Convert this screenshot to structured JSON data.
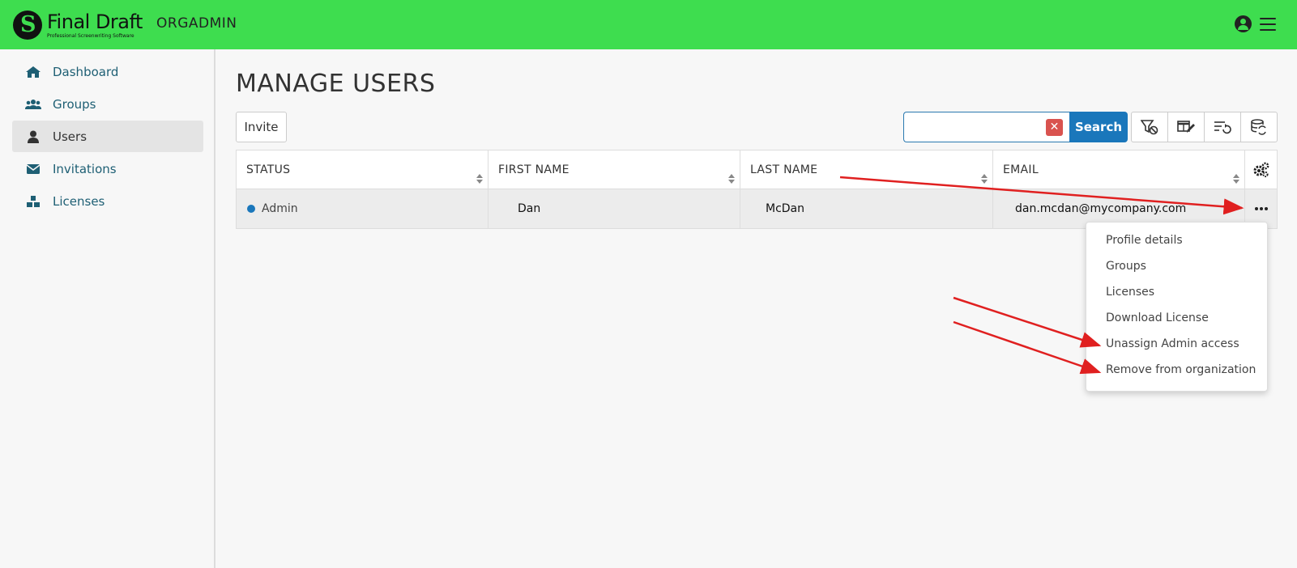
{
  "header": {
    "logo_name": "Final Draft",
    "logo_tagline": "Professional Screenwriting Software",
    "org_name": "ORGADMIN",
    "colors": {
      "bar": "#3edd4f"
    }
  },
  "sidebar": {
    "items": [
      {
        "label": "Dashboard",
        "icon": "home-icon"
      },
      {
        "label": "Groups",
        "icon": "users-icon"
      },
      {
        "label": "Users",
        "icon": "user-icon",
        "active": true
      },
      {
        "label": "Invitations",
        "icon": "envelope-icon"
      },
      {
        "label": "Licenses",
        "icon": "boxes-icon"
      }
    ]
  },
  "main": {
    "title": "MANAGE USERS",
    "invite_label": "Invite",
    "search": {
      "value": "",
      "placeholder": "",
      "button_label": "Search"
    },
    "tools": [
      "clear-filter-icon",
      "edit-columns-icon",
      "reset-sort-icon",
      "refresh-data-icon"
    ]
  },
  "table": {
    "columns": [
      "STATUS",
      "FIRST NAME",
      "LAST NAME",
      "EMAIL"
    ],
    "rows": [
      {
        "status": "Admin",
        "first_name": "Dan",
        "last_name": "McDan",
        "email": "dan.mcdan@mycompany.com"
      }
    ]
  },
  "row_menu": {
    "items": [
      "Profile details",
      "Groups",
      "Licenses",
      "Download License",
      "Unassign Admin access",
      "Remove from organization"
    ]
  },
  "annotations": {
    "arrow_color": "#e02020"
  }
}
